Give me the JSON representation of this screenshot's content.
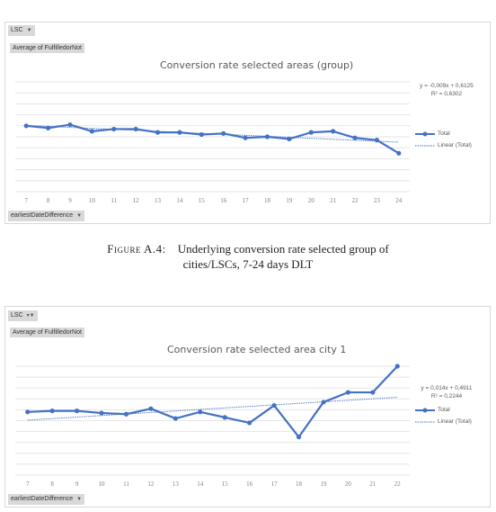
{
  "figure_caption": {
    "label": "Figure A.4:",
    "line1": "Underlying conversion rate selected group of",
    "line2": "cities/LSCs, 7-24 days DLT"
  },
  "chart_data": [
    {
      "type": "line",
      "title": "Conversion rate selected areas (group)",
      "filter_button": "LSC",
      "filter_icon": "dropdown-arrow-icon",
      "value_button": "Average of FulfilledorNot",
      "axis_button": "earliestDateDifference",
      "xlabel": "",
      "ylabel": "",
      "y_tick_labels_visible": false,
      "ylim": [
        0,
        1
      ],
      "grid": true,
      "categories": [
        "7",
        "8",
        "9",
        "10",
        "11",
        "12",
        "13",
        "14",
        "15",
        "16",
        "17",
        "18",
        "19",
        "20",
        "21",
        "22",
        "23",
        "24"
      ],
      "series": [
        {
          "name": "Total",
          "values": [
            0.6,
            0.58,
            0.61,
            0.55,
            0.57,
            0.57,
            0.54,
            0.54,
            0.52,
            0.53,
            0.49,
            0.5,
            0.48,
            0.54,
            0.55,
            0.49,
            0.47,
            0.35
          ]
        }
      ],
      "trendline": {
        "name": "Linear (Total)",
        "slope": -0.009,
        "intercept": 0.6125,
        "equation": "y = -0,009x + 0,6125",
        "r2": "R² = 0,6302"
      },
      "legend": [
        "Total",
        "Linear (Total)"
      ],
      "legend_position": "right",
      "colors": {
        "series": "#4472c4",
        "trend": "#4472c4",
        "grid": "#e6e6e6"
      }
    },
    {
      "type": "line",
      "title": "Conversion rate selected area city 1",
      "filter_button": "LSC",
      "filter_icon": "filter-funnel-icon",
      "value_button": "Average of FulfilledorNot",
      "axis_button": "earliestDateDifference",
      "xlabel": "",
      "ylabel": "",
      "y_tick_labels_visible": false,
      "ylim": [
        0,
        1
      ],
      "grid": true,
      "categories": [
        "7",
        "8",
        "9",
        "10",
        "11",
        "12",
        "13",
        "14",
        "15",
        "16",
        "17",
        "18",
        "19",
        "20",
        "21",
        "22"
      ],
      "series": [
        {
          "name": "Total",
          "values": [
            0.58,
            0.59,
            0.59,
            0.57,
            0.56,
            0.61,
            0.52,
            0.58,
            0.53,
            0.48,
            0.64,
            0.35,
            0.67,
            0.76,
            0.76,
            1.0
          ]
        }
      ],
      "trendline": {
        "name": "Linear (Total)",
        "slope": 0.014,
        "intercept": 0.4911,
        "equation": "y = 0,014x + 0,4911",
        "r2": "R² = 0,2244"
      },
      "legend": [
        "Total",
        "Linear (Total)"
      ],
      "legend_position": "right",
      "colors": {
        "series": "#4472c4",
        "trend": "#4472c4",
        "grid": "#e6e6e6"
      }
    }
  ]
}
